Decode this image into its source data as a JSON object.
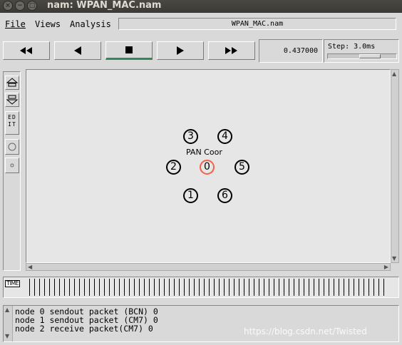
{
  "window": {
    "title": "nam: WPAN_MAC.nam",
    "buttons": [
      "×",
      "−",
      "□"
    ]
  },
  "menu": {
    "file": "File",
    "views": "Views",
    "analysis": "Analysis",
    "filename": "WPAN_MAC.nam"
  },
  "controls": {
    "rewind": "rewind-icon",
    "back": "play-back-icon",
    "stop": "stop-icon",
    "play": "play-icon",
    "fast_forward": "fast-forward-icon",
    "time_value": "0.437000",
    "step_label": "Step: 3.0ms",
    "active_color": "#2e8b57"
  },
  "tools": {
    "edit_label": "ED IT"
  },
  "network": {
    "coordinator_label": "PAN Coor",
    "coordinator_color": "#f0624a",
    "nodes": [
      "0",
      "1",
      "2",
      "3",
      "4",
      "5",
      "6"
    ]
  },
  "timeline": {
    "tag": "TIME"
  },
  "log": {
    "lines": [
      "node 0 sendout packet (BCN) 0",
      "node 1 sendout packet (CM7) 0",
      "node 2 receive packet(CM7) 0"
    ]
  },
  "watermark": "https://blog.csdn.net/Twisted"
}
